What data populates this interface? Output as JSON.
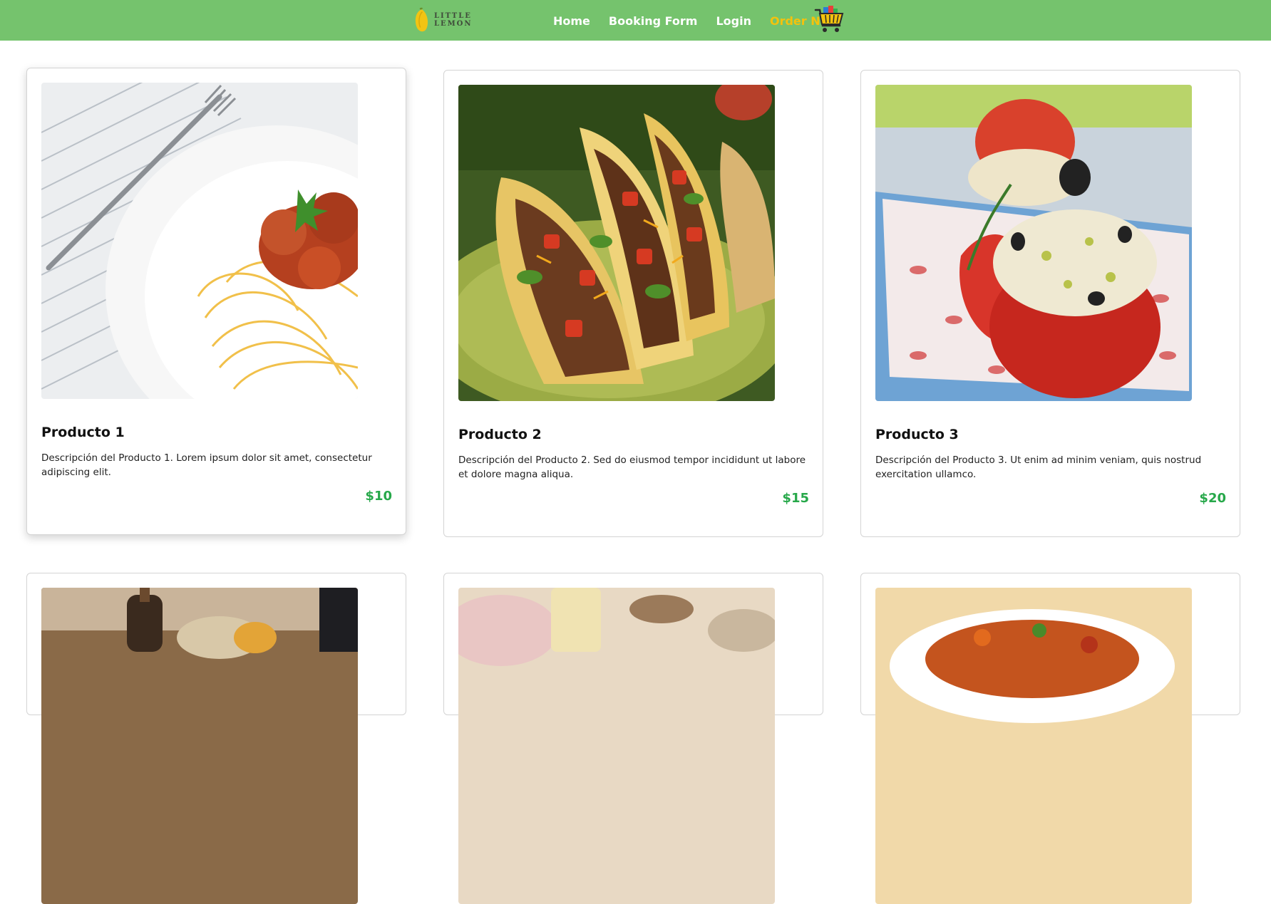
{
  "header": {
    "brand": "LITTLE LEMON",
    "nav": [
      "Home",
      "Booking Form",
      "Login",
      "Order Now"
    ],
    "bar_color": "#75c36d",
    "order_color": "#f4c20d",
    "cart_icon": "shopping-cart-icon"
  },
  "products": [
    {
      "title": "Producto 1",
      "description": "Descripción del Producto 1. Lorem ipsum dolor sit amet, consectetur adipiscing elit.",
      "price": "$10",
      "image": "spaghetti-meatballs"
    },
    {
      "title": "Producto 2",
      "description": "Descripción del Producto 2. Sed do eiusmod tempor incididunt ut labore et dolore magna aliqua.",
      "price": "$15",
      "image": "tacos"
    },
    {
      "title": "Producto 3",
      "description": "Descripción del Producto 3. Ut enim ad minim veniam, quis nostrud exercitation ullamco.",
      "price": "$20",
      "image": "stuffed-tomato"
    },
    {
      "title": "",
      "description": "",
      "price": "",
      "image": "food-platter"
    },
    {
      "title": "",
      "description": "",
      "price": "",
      "image": "drinks-table"
    },
    {
      "title": "",
      "description": "",
      "price": "",
      "image": "pasta-bowl"
    }
  ],
  "price_color": "#27a84a"
}
